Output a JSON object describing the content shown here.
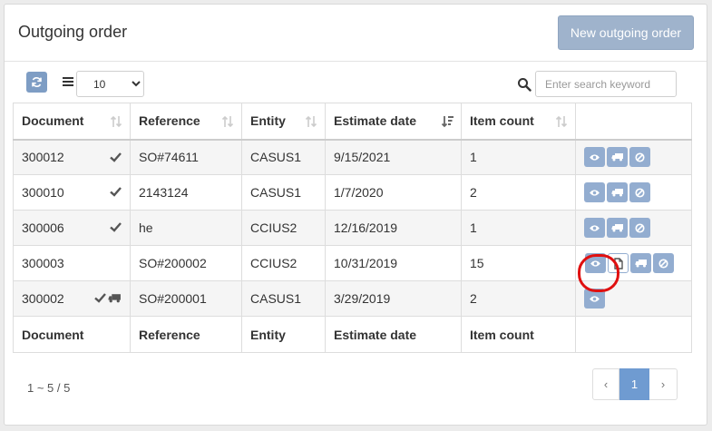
{
  "header": {
    "title": "Outgoing order",
    "new_button": "New outgoing order"
  },
  "toolbar": {
    "page_size": "10",
    "page_size_options": [
      "10"
    ],
    "search_placeholder": "Enter search keyword"
  },
  "table": {
    "columns": [
      "Document",
      "Reference",
      "Entity",
      "Estimate date",
      "Item count"
    ],
    "rows": [
      {
        "document": "300012",
        "reference": "SO#74611",
        "entity": "CASUS1",
        "estimate_date": "9/15/2021",
        "item_count": "1"
      },
      {
        "document": "300010",
        "reference": "2143124",
        "entity": "CASUS1",
        "estimate_date": "1/7/2020",
        "item_count": "2"
      },
      {
        "document": "300006",
        "reference": "he",
        "entity": "CCIUS2",
        "estimate_date": "12/16/2019",
        "item_count": "1"
      },
      {
        "document": "300003",
        "reference": "SO#200002",
        "entity": "CCIUS2",
        "estimate_date": "10/31/2019",
        "item_count": "15"
      },
      {
        "document": "300002",
        "reference": "SO#200001",
        "entity": "CASUS1",
        "estimate_date": "3/29/2019",
        "item_count": "2"
      }
    ]
  },
  "footer": {
    "info": "1 ~ 5 / 5",
    "prev": "‹",
    "page": "1",
    "next": "›"
  },
  "colors": {
    "button": "#93add0",
    "active_page": "#6f9bd1",
    "highlight": "#e01010"
  }
}
